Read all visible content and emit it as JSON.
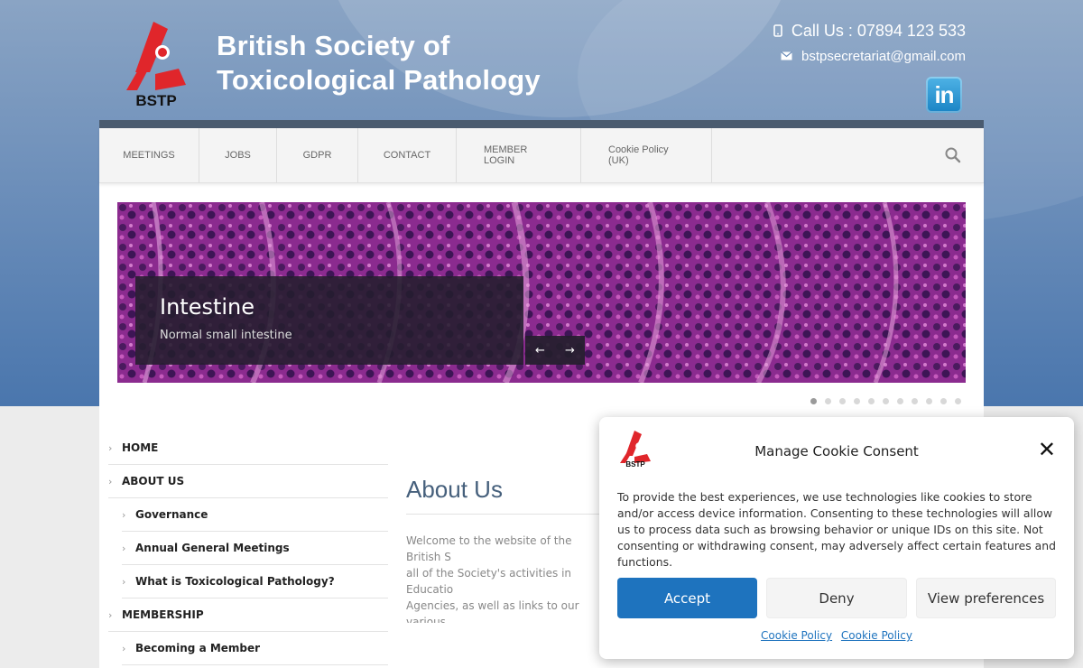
{
  "header": {
    "logo_text": "BSTP",
    "title_line1": "British Society of",
    "title_line2": "Toxicological Pathology",
    "phone": "Call Us : 07894 123 533",
    "email": "bstpsecretariat@gmail.com",
    "linkedin_label": "in"
  },
  "nav": {
    "items": [
      "MEETINGS",
      "JOBS",
      "GDPR",
      "CONTACT",
      "MEMBER LOGIN",
      "Cookie Policy (UK)"
    ]
  },
  "slider": {
    "title": "Intestine",
    "subtitle": "Normal small intestine",
    "prev": "←",
    "next": "→",
    "dot_count": 11,
    "active_dot": 0
  },
  "sidebar": {
    "items": [
      {
        "label": "HOME",
        "level": 0
      },
      {
        "label": "ABOUT US",
        "level": 0
      },
      {
        "label": "Governance",
        "level": 1
      },
      {
        "label": "Annual General Meetings",
        "level": 1
      },
      {
        "label": "What is Toxicological Pathology?",
        "level": 1
      },
      {
        "label": "MEMBERSHIP",
        "level": 0
      },
      {
        "label": "Becoming a Member",
        "level": 1
      }
    ]
  },
  "main": {
    "title": "About Us",
    "text": "Welcome to the website of the British S\nall of the Society's activities in Educatio\nAgencies, as well as links to our various\nhave a members-only section containi\nideas for new content please contact o"
  },
  "cookie_banner": {
    "title": "Manage Cookie Consent",
    "close": "✕",
    "body": "To provide the best experiences, we use technologies like cookies to store and/or access device information. Consenting to these technologies will allow us to process data such as browsing behavior or unique IDs on this site. Not consenting or withdrawing consent, may adversely affect certain features and functions.",
    "accept": "Accept",
    "deny": "Deny",
    "preferences": "View preferences",
    "link1": "Cookie Policy",
    "link2": "Cookie Policy",
    "accent_color": "#1e73be"
  },
  "icons": [
    "bstp-logo-icon",
    "phone-icon",
    "envelope-icon",
    "linkedin-icon",
    "search-icon",
    "chevron-right-icon",
    "close-icon"
  ]
}
